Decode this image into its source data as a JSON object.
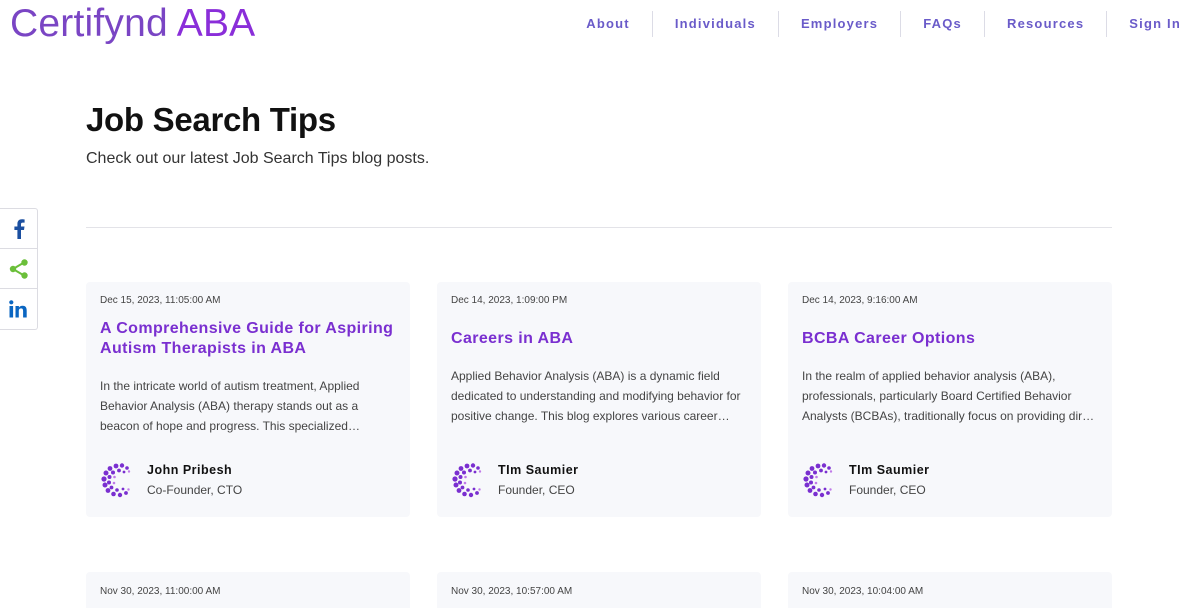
{
  "header": {
    "logo_brand": "Certifynd",
    "logo_suffix": "ABA",
    "nav": [
      "About",
      "Individuals",
      "Employers",
      "FAQs",
      "Resources",
      "Sign In"
    ]
  },
  "page": {
    "title": "Job Search Tips",
    "subtitle": "Check out our latest Job Search Tips blog posts."
  },
  "share": {
    "icons": [
      "facebook-icon",
      "share-icon",
      "linkedin-icon"
    ]
  },
  "posts": [
    {
      "date": "Dec 15, 2023, 11:05:00 AM",
      "title": "A Comprehensive Guide for Aspiring Autism Therapists in ABA",
      "excerpt": "In the intricate world of autism treatment, Applied Behavior Analysis (ABA) therapy stands out as a beacon of hope and progress. This specialized approach, rooted in the science of learning and behavior",
      "author": "John Pribesh",
      "role": "Co-Founder, CTO"
    },
    {
      "date": "Dec 14, 2023, 1:09:00 PM",
      "title": "Careers in ABA",
      "excerpt": "Applied Behavior Analysis (ABA) is a dynamic field dedicated to understanding and modifying behavior for positive change. This blog explores various career paths within ABA",
      "author": "TIm Saumier",
      "role": "Founder, CEO"
    },
    {
      "date": "Dec 14, 2023, 9:16:00 AM",
      "title": "BCBA Career Options",
      "excerpt": "In the realm of applied behavior analysis (ABA), professionals, particularly Board Certified Behavior Analysts (BCBAs), traditionally focus on providing direct services",
      "author": "TIm Saumier",
      "role": "Founder, CEO"
    },
    {
      "date": "Nov 30, 2023, 11:00:00 AM"
    },
    {
      "date": "Nov 30, 2023, 10:57:00 AM"
    },
    {
      "date": "Nov 30, 2023, 10:04:00 AM"
    }
  ],
  "colors": {
    "brand": "#7a45c4",
    "accent": "#8a2ed9",
    "nav": "#6a5bc9",
    "facebook": "#1b4fa0",
    "share": "#6bbf3a",
    "linkedin": "#0a66c2"
  }
}
